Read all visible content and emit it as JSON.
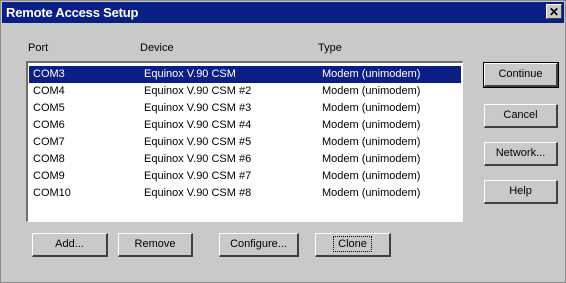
{
  "window": {
    "title": "Remote Access Setup",
    "close_glyph": "✕"
  },
  "columns": {
    "port": "Port",
    "device": "Device",
    "type": "Type"
  },
  "rows": [
    {
      "port": "COM3",
      "device": "Equinox V.90 CSM",
      "type": "Modem (unimodem)",
      "selected": true
    },
    {
      "port": "COM4",
      "device": "Equinox V.90 CSM #2",
      "type": "Modem (unimodem)"
    },
    {
      "port": "COM5",
      "device": "Equinox V.90 CSM #3",
      "type": "Modem (unimodem)"
    },
    {
      "port": "COM6",
      "device": "Equinox V.90 CSM #4",
      "type": "Modem (unimodem)"
    },
    {
      "port": "COM7",
      "device": "Equinox V.90 CSM #5",
      "type": "Modem (unimodem)"
    },
    {
      "port": "COM8",
      "device": "Equinox V.90 CSM #6",
      "type": "Modem (unimodem)"
    },
    {
      "port": "COM9",
      "device": "Equinox V.90 CSM #7",
      "type": "Modem (unimodem)"
    },
    {
      "port": "COM10",
      "device": "Equinox V.90 CSM #8",
      "type": "Modem (unimodem)"
    }
  ],
  "side_buttons": {
    "continue": "Continue",
    "cancel": "Cancel",
    "network": "Network...",
    "help": "Help"
  },
  "bottom_buttons": {
    "add": "Add...",
    "remove": "Remove",
    "configure": "Configure...",
    "clone": "Clone"
  },
  "colors": {
    "titlebar": "#0a1f86",
    "selection": "#0a1f86",
    "face": "#c9c9c9"
  }
}
